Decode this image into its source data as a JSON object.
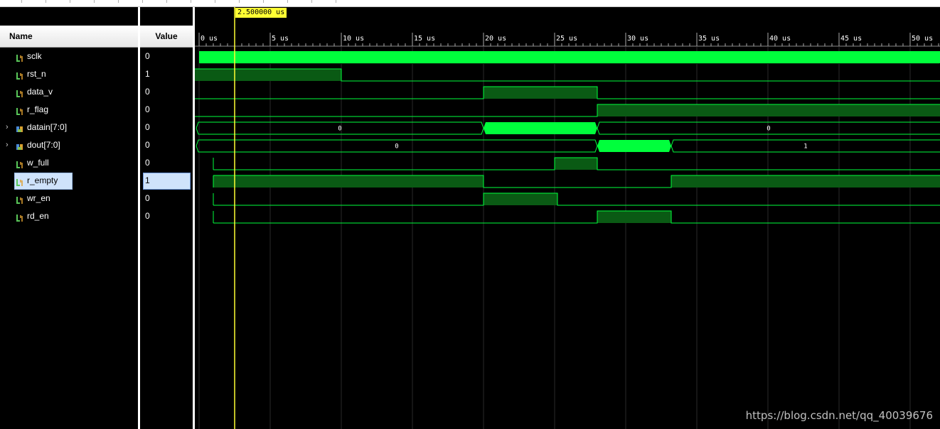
{
  "columns": {
    "name": "Name",
    "value": "Value"
  },
  "cursor": {
    "label": "2.500000 us"
  },
  "ruler": {
    "ticks": [
      "0 us",
      "5 us",
      "10 us",
      "15 us",
      "20 us",
      "25 us",
      "30 us",
      "35 us",
      "40 us",
      "45 us",
      "50 us"
    ]
  },
  "signals": [
    {
      "name": "sclk",
      "value": "0",
      "icon": "wire-icon"
    },
    {
      "name": "rst_n",
      "value": "1",
      "icon": "wire-icon"
    },
    {
      "name": "data_v",
      "value": "0",
      "icon": "wire-icon"
    },
    {
      "name": "r_flag",
      "value": "0",
      "icon": "wire-icon"
    },
    {
      "name": "datain[7:0]",
      "value": "0",
      "icon": "bus-icon",
      "expandable": true
    },
    {
      "name": "dout[7:0]",
      "value": "0",
      "icon": "bus-icon",
      "expandable": true
    },
    {
      "name": "w_full",
      "value": "0",
      "icon": "wire-icon"
    },
    {
      "name": "r_empty",
      "value": "1",
      "icon": "wire-icon",
      "selected": true
    },
    {
      "name": "wr_en",
      "value": "0",
      "icon": "wire-icon"
    },
    {
      "name": "rd_en",
      "value": "0",
      "icon": "wire-icon"
    }
  ],
  "bus_labels": {
    "datain_a": "0",
    "datain_b": "0",
    "dout_a": "0",
    "dout_b": "1"
  },
  "colors": {
    "wave_high": "#00ff3c",
    "wave_fill": "#0a5a14",
    "grid": "#2a2a2a",
    "cursor": "#ffff33"
  },
  "watermark": "https://blog.csdn.net/qq_40039676"
}
